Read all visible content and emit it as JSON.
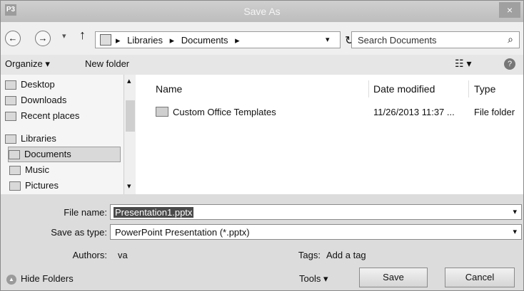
{
  "window": {
    "title": "Save As",
    "app_icon": "P3",
    "close": "×"
  },
  "nav": {
    "back": "←",
    "forward": "→",
    "recent": "▾",
    "up": "↑",
    "breadcrumbs": [
      "Libraries",
      "Documents"
    ],
    "crumb_sep": "▸",
    "address_drop": "▾",
    "refresh": "↻",
    "search_placeholder": "Search Documents",
    "search_icon": "⌕"
  },
  "toolbar": {
    "organize": "Organize ▾",
    "new_folder": "New folder",
    "view": "☷ ▾",
    "help": "?"
  },
  "sidebar": {
    "items": [
      {
        "label": "Desktop"
      },
      {
        "label": "Downloads"
      },
      {
        "label": "Recent places"
      },
      {
        "label": "Libraries"
      },
      {
        "label": "Documents"
      },
      {
        "label": "Music"
      },
      {
        "label": "Pictures"
      }
    ],
    "scroll_up": "▴",
    "scroll_down": "▾"
  },
  "files": {
    "columns": {
      "name": "Name",
      "date": "Date modified",
      "type": "Type"
    },
    "rows": [
      {
        "name": "Custom Office Templates",
        "date": "11/26/2013 11:37 ...",
        "type": "File folder"
      }
    ]
  },
  "form": {
    "file_name_label": "File name:",
    "file_name_value": "Presentation1.pptx",
    "save_type_label": "Save as type:",
    "save_type_value": "PowerPoint Presentation (*.pptx)",
    "authors_label": "Authors:",
    "authors_value": "va",
    "tags_label": "Tags:",
    "tags_value": "Add a tag",
    "dropdown": "▾"
  },
  "footer": {
    "hide_folders": "Hide Folders",
    "hide_icon": "▲",
    "tools": "Tools ▾",
    "save": "Save",
    "cancel": "Cancel"
  }
}
